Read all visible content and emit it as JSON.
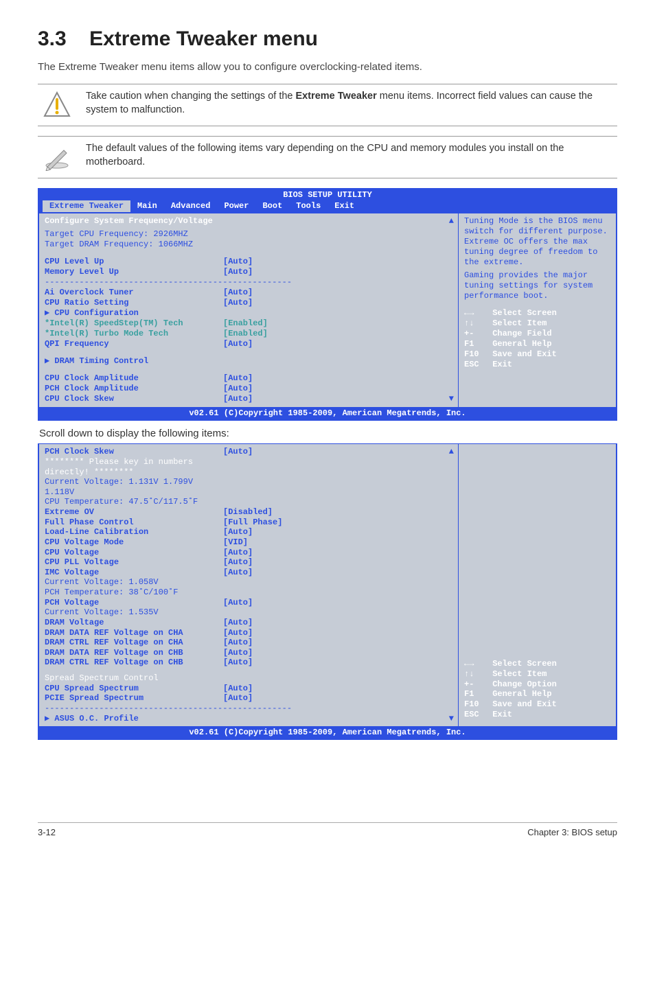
{
  "section": {
    "number": "3.3",
    "title": "Extreme Tweaker menu"
  },
  "intro": "The Extreme Tweaker menu items allow you to configure overclocking-related items.",
  "note_caution": {
    "line1_a": "Take caution when changing the settings of the ",
    "line1_bold": "Extreme Tweaker",
    "line1_b": " menu items. Incorrect field values can cause the system to malfunction."
  },
  "note_info": "The default values of the following items vary depending on the CPU and memory modules you install on the motherboard.",
  "bios": {
    "title": "BIOS SETUP UTILITY",
    "tabs": [
      "Extreme Tweaker",
      "Main",
      "Advanced",
      "Power",
      "Boot",
      "Tools",
      "Exit"
    ],
    "heading": "Configure System Frequency/Voltage",
    "target_cpu": "Target CPU Frequency: 2926MHZ",
    "target_dram": "Target DRAM Frequency: 1066MHZ",
    "rows": [
      {
        "label": "CPU Level Up",
        "val": "[Auto]",
        "cls": "bold"
      },
      {
        "label": "Memory Level Up",
        "val": "[Auto]",
        "cls": "bold"
      }
    ],
    "rows2": [
      {
        "label": "Ai Overclock Tuner",
        "val": "[Auto]",
        "cls": "bold"
      },
      {
        "label": "CPU Ratio Setting",
        "val": "[Auto]",
        "cls": "bold"
      },
      {
        "label": "▶ CPU Configuration",
        "val": "",
        "cls": "bold"
      },
      {
        "label": "*Intel(R) SpeedStep(TM) Tech",
        "val": "[Enabled]",
        "cls": "teal"
      },
      {
        "label": "*Intel(R) Turbo Mode Tech",
        "val": "[Enabled]",
        "cls": "teal"
      },
      {
        "label": "QPI Frequency",
        "val": "[Auto]",
        "cls": "bold"
      }
    ],
    "rows3": [
      {
        "label": "▶ DRAM Timing Control",
        "val": "",
        "cls": "bold"
      }
    ],
    "rows4": [
      {
        "label": "CPU Clock Amplitude",
        "val": "[Auto]",
        "cls": "bold"
      },
      {
        "label": "PCH Clock Amplitude",
        "val": "[Auto]",
        "cls": "bold"
      },
      {
        "label": "CPU Clock Skew",
        "val": "[Auto]",
        "cls": "bold"
      }
    ],
    "help1": "Tuning Mode is the BIOS menu switch for different purpose. Extreme OC offers the max tuning degree of freedom to the extreme.",
    "help2": "Gaming provides the major tuning settings for system performance boot.",
    "keys": [
      {
        "k": "←→",
        "t": "Select Screen"
      },
      {
        "k": "↑↓",
        "t": "Select Item"
      },
      {
        "k": "+-",
        "t": "Change Field"
      },
      {
        "k": "F1",
        "t": "General Help"
      },
      {
        "k": "F10",
        "t": "Save and Exit"
      },
      {
        "k": "ESC",
        "t": "Exit"
      }
    ],
    "footer": "v02.61 (C)Copyright 1985-2009, American Megatrends, Inc."
  },
  "scroll_caption": "Scroll down to display the following items:",
  "bios2": {
    "rows": [
      {
        "label": "PCH Clock Skew",
        "val": "[Auto]",
        "cls": "bold"
      },
      {
        "label": "******** Please key in numbers directly! ********",
        "val": "",
        "cls": "white"
      },
      {
        "label": "Current Voltage: 1.131V  1.799V  1.118V",
        "val": "",
        "cls": ""
      },
      {
        "label": "CPU Temperature: 47.5˚C/117.5˚F",
        "val": "",
        "cls": ""
      },
      {
        "label": "Extreme OV",
        "val": "[Disabled]",
        "cls": "bold"
      },
      {
        "label": "Full Phase Control",
        "val": "[Full Phase]",
        "cls": "bold"
      },
      {
        "label": "Load-Line Calibration",
        "val": "[Auto]",
        "cls": "bold"
      },
      {
        "label": "CPU Voltage Mode",
        "val": "[VID]",
        "cls": "bold"
      },
      {
        "label": "CPU Voltage",
        "val": "[Auto]",
        "cls": "bold"
      },
      {
        "label": "CPU PLL Voltage",
        "val": "[Auto]",
        "cls": "bold"
      },
      {
        "label": "IMC Voltage",
        "val": "[Auto]",
        "cls": "bold"
      },
      {
        "label": "Current Voltage: 1.058V",
        "val": "",
        "cls": ""
      },
      {
        "label": "PCH Temperature: 38˚C/100˚F",
        "val": "",
        "cls": ""
      },
      {
        "label": "PCH Voltage",
        "val": "[Auto]",
        "cls": "bold"
      },
      {
        "label": "Current Voltage: 1.535V",
        "val": "",
        "cls": ""
      },
      {
        "label": "DRAM Voltage",
        "val": " [Auto]",
        "cls": "bold"
      },
      {
        "label": "DRAM DATA REF Voltage on CHA",
        "val": "[Auto]",
        "cls": "bold"
      },
      {
        "label": "DRAM CTRL REF Voltage on CHA",
        "val": "[Auto]",
        "cls": "bold"
      },
      {
        "label": "DRAM DATA REF Voltage on CHB",
        "val": "[Auto]",
        "cls": "bold"
      },
      {
        "label": "DRAM CTRL REF Voltage on CHB",
        "val": "[Auto]",
        "cls": "bold"
      }
    ],
    "rows2": [
      {
        "label": "Spread Spectrum Control",
        "val": "",
        "cls": "white"
      },
      {
        "label": "CPU Spread Spectrum",
        "val": "[Auto]",
        "cls": "bold"
      },
      {
        "label": "PCIE Spread Spectrum",
        "val": "[Auto]",
        "cls": "bold"
      }
    ],
    "rows3": [
      {
        "label": "▶ ASUS O.C. Profile",
        "val": "",
        "cls": "bold"
      }
    ],
    "keys": [
      {
        "k": "←→",
        "t": "Select Screen"
      },
      {
        "k": "↑↓",
        "t": "Select Item"
      },
      {
        "k": "+-",
        "t": "Change Option"
      },
      {
        "k": "F1",
        "t": "General Help"
      },
      {
        "k": "F10",
        "t": "Save and Exit"
      },
      {
        "k": "ESC",
        "t": "Exit"
      }
    ],
    "footer": "v02.61 (C)Copyright 1985-2009, American Megatrends, Inc."
  },
  "page_footer": {
    "left": "3-12",
    "right": "Chapter 3: BIOS setup"
  }
}
